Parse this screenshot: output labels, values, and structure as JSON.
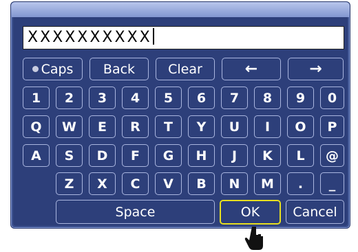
{
  "input": {
    "value": "XXXXXXXXXX"
  },
  "row_controls": {
    "caps": "Caps",
    "back": "Back",
    "clear": "Clear",
    "left_icon": "left-arrow-icon",
    "right_icon": "right-arrow-icon"
  },
  "row_numbers": [
    "1",
    "2",
    "3",
    "4",
    "5",
    "6",
    "7",
    "8",
    "9",
    "0"
  ],
  "row_q": [
    "Q",
    "W",
    "E",
    "R",
    "T",
    "Y",
    "U",
    "I",
    "O",
    "P"
  ],
  "row_a": [
    "A",
    "S",
    "D",
    "F",
    "G",
    "H",
    "J",
    "K",
    "L",
    "@"
  ],
  "row_z": [
    "Z",
    "X",
    "C",
    "V",
    "B",
    "N",
    "M",
    ".",
    "_"
  ],
  "row_bottom": {
    "space": "Space",
    "ok": "OK",
    "cancel": "Cancel"
  },
  "colors": {
    "panel": "#2d3f7a",
    "key_border": "#aab6e0",
    "focus": "#e8e020"
  }
}
